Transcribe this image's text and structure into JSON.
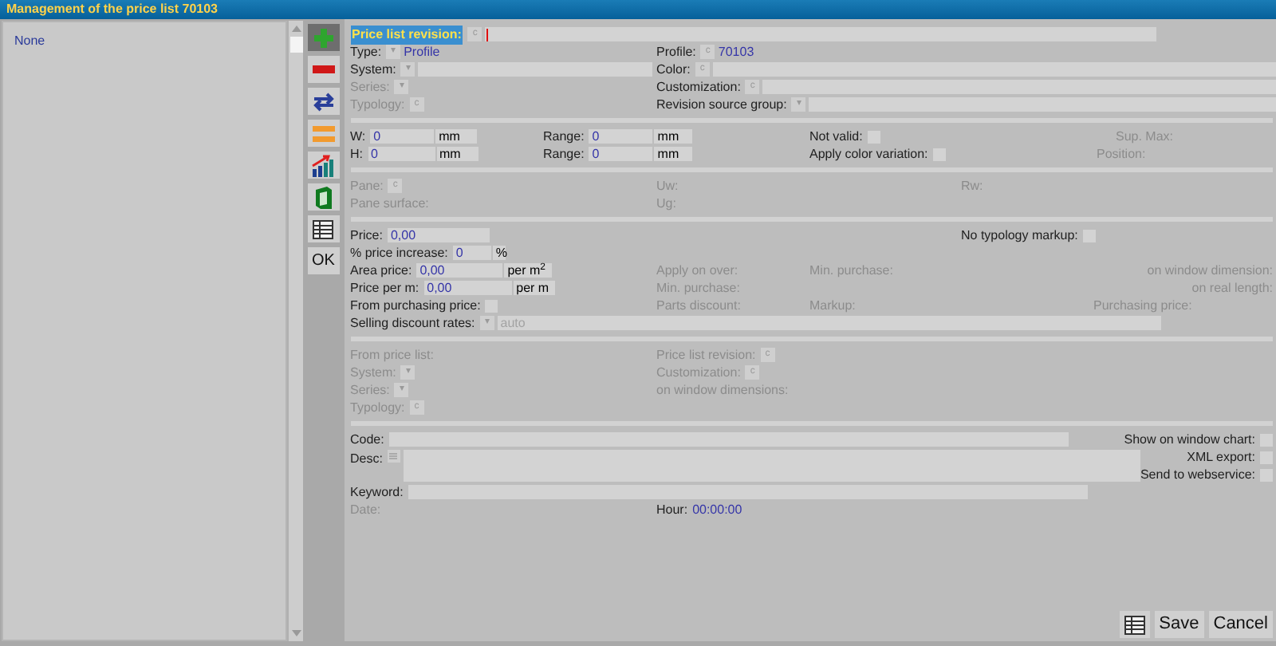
{
  "title": "Management of the price list 70103",
  "list": {
    "items": [
      {
        "label": "None",
        "selected": false
      }
    ]
  },
  "toolbar": [
    {
      "kind": "add",
      "pressed": true
    },
    {
      "kind": "remove",
      "pressed": false
    },
    {
      "kind": "swap",
      "pressed": false
    },
    {
      "kind": "equal",
      "pressed": false
    },
    {
      "kind": "chart",
      "pressed": false
    },
    {
      "kind": "book",
      "pressed": false
    },
    {
      "kind": "table",
      "pressed": false
    },
    {
      "kind": "text",
      "label": "OK",
      "pressed": false
    }
  ],
  "general": {
    "revision": {
      "label": "Price list revision:",
      "picker": "c",
      "focused": true
    },
    "type": {
      "label": "Type:",
      "picker": "▾",
      "value": "Profile",
      "disabled": false
    },
    "system": {
      "label": "System:",
      "picker": "▾",
      "disabled": false
    },
    "series": {
      "label": "Series:",
      "picker": "▾",
      "disabled": true
    },
    "typology": {
      "label": "Typology:",
      "picker": "c",
      "disabled": true
    },
    "profile": {
      "label": "Profile:",
      "picker": "c",
      "value": "70103",
      "disabled": false
    },
    "color": {
      "label": "Color:",
      "picker": "c",
      "disabled": false
    },
    "customization": {
      "label": "Customization:",
      "picker": "c",
      "disabled": false
    },
    "source_group": {
      "label": "Revision source group:",
      "picker": "▾",
      "disabled": false
    }
  },
  "dimensions": {
    "width": {
      "label": "W:",
      "value": "0",
      "unit": "mm",
      "disabled": false
    },
    "width_range": {
      "label": "Range:",
      "value": "0",
      "unit": "mm",
      "disabled": false
    },
    "height": {
      "label": "H:",
      "value": "0",
      "unit": "mm",
      "disabled": false
    },
    "height_range": {
      "label": "Range:",
      "value": "0",
      "unit": "mm",
      "disabled": false
    },
    "not_valid": {
      "label": "Not valid:",
      "checked": false,
      "disabled": false
    },
    "apply_color_variation": {
      "label": "Apply color variation:",
      "checked": false,
      "disabled": false
    },
    "sup_max": {
      "label": "Sup. Max:",
      "disabled": true
    },
    "position": {
      "label": "Position:",
      "disabled": true
    }
  },
  "glass": {
    "pane": {
      "label": "Pane:",
      "picker": "c",
      "disabled": true
    },
    "pane_surface": {
      "label": "Pane surface:",
      "disabled": true
    },
    "uw": {
      "label": "Uw:",
      "disabled": true
    },
    "ug": {
      "label": "Ug:",
      "disabled": true
    },
    "rw": {
      "label": "Rw:",
      "disabled": true
    }
  },
  "pricing": {
    "price": {
      "label": "Price:",
      "value": "0,00",
      "disabled": false
    },
    "no_typology_markup": {
      "label": "No typology markup:",
      "checked": false,
      "disabled": false
    },
    "increase": {
      "label": "% price increase:",
      "value": "0",
      "unit": "%",
      "disabled": false
    },
    "area_price": {
      "label": "Area price:",
      "value": "0,00",
      "unit": "per m$^{2}$",
      "disabled": false
    },
    "apply_on_over": {
      "label": "Apply on over:",
      "disabled": true
    },
    "min_purchase": {
      "label": "Min. purchase:",
      "disabled": true
    },
    "on_window_dimension": {
      "label": "on window dimension:",
      "disabled": true
    },
    "price_per_m": {
      "label": "Price per m:",
      "value": "0,00",
      "unit": "per m",
      "disabled": false
    },
    "min_purchase_m": {
      "label": "Min. purchase:",
      "disabled": true
    },
    "on_real_length": {
      "label": "on real length:",
      "disabled": true
    },
    "from_purchasing_price": {
      "label": "From purchasing price:",
      "checked": false,
      "disabled": false
    },
    "parts_discount": {
      "label": "Parts discount:",
      "disabled": true
    },
    "markup": {
      "label": "Markup:",
      "disabled": true
    },
    "purchasing_price": {
      "label": "Purchasing price:",
      "disabled": true
    },
    "selling_discount_rates": {
      "label": "Selling discount rates:",
      "picker": "▾",
      "placeholder": "auto",
      "disabled": false
    }
  },
  "source": {
    "from_price_list": {
      "label": "From price list:",
      "disabled": true
    },
    "price_list_revision": {
      "label": "Price list revision:",
      "picker": "c",
      "disabled": true
    },
    "system": {
      "label": "System:",
      "picker": "▾",
      "disabled": true
    },
    "customization": {
      "label": "Customization:",
      "picker": "c",
      "disabled": true
    },
    "series": {
      "label": "Series:",
      "picker": "▾",
      "disabled": true
    },
    "on_window_dimensions": {
      "label": "on window dimensions:",
      "disabled": true
    },
    "typology": {
      "label": "Typology:",
      "picker": "c",
      "disabled": true
    }
  },
  "info": {
    "code": {
      "label": "Code:",
      "disabled": false
    },
    "show_on_window_chart": {
      "label": "Show on window chart:",
      "checked": false,
      "disabled": false
    },
    "desc": {
      "label": "Desc:",
      "disabled": false
    },
    "xml_export": {
      "label": "XML export:",
      "checked": false,
      "disabled": false
    },
    "send_to_webservice": {
      "label": "Send to webservice:",
      "checked": false,
      "disabled": false
    },
    "keyword": {
      "label": "Keyword:",
      "disabled": false
    },
    "date": {
      "label": "Date:",
      "disabled": true
    },
    "hour": {
      "label": "Hour:",
      "value": "00:00:00",
      "disabled": false
    }
  },
  "footer": {
    "buttons": [
      {
        "kind": "table"
      },
      {
        "kind": "text",
        "label": "Save"
      },
      {
        "kind": "text",
        "label": "Cancel"
      }
    ]
  }
}
